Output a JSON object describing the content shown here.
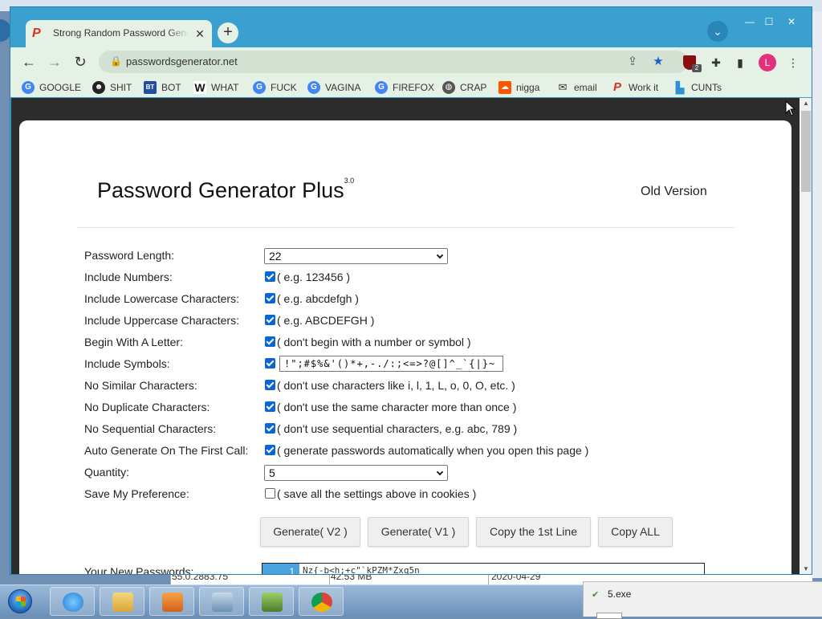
{
  "browser": {
    "tab_title": "Strong Random Password Generator",
    "tab_close": "✕",
    "new_tab": "+",
    "tab_search": "⌄",
    "url": "passwordsgenerator.net",
    "profile_initial": "L",
    "ublock_badge": "2",
    "window_controls": [
      "—",
      "☐",
      "✕"
    ]
  },
  "bookmarks": [
    {
      "label": "GOOGLE",
      "icon": "google-icon",
      "color": "#4285f4",
      "glyph": "G"
    },
    {
      "label": "SHIT",
      "icon": "smiley-icon",
      "color": "#222222",
      "glyph": "☻"
    },
    {
      "label": "BOT",
      "icon": "bt-icon",
      "color": "#1f4fa0",
      "glyph": "BT"
    },
    {
      "label": "WHAT",
      "icon": "w-icon",
      "color": "#111111",
      "glyph": "W"
    },
    {
      "label": "FUCK",
      "icon": "google-icon",
      "color": "#4285f4",
      "glyph": "G"
    },
    {
      "label": "VAGINA",
      "icon": "google-icon",
      "color": "#4285f4",
      "glyph": "G"
    },
    {
      "label": "FIREFOX",
      "icon": "google-icon",
      "color": "#4285f4",
      "glyph": "G"
    },
    {
      "label": "CRAP",
      "icon": "globe-icon",
      "color": "#555555",
      "glyph": "◍"
    },
    {
      "label": "nigga",
      "icon": "soundcloud-icon",
      "color": "#ff5500",
      "glyph": "☁"
    },
    {
      "label": "email",
      "icon": "mail-icon",
      "color": "#333333",
      "glyph": "✉"
    },
    {
      "label": "Work it",
      "icon": "p-icon",
      "color": "#d93025",
      "glyph": "P"
    },
    {
      "label": "CUNTs",
      "icon": "bookmark-icon",
      "color": "#2f8fd8",
      "glyph": "▙"
    }
  ],
  "page": {
    "title": "Password Generator Plus",
    "version": "3.0",
    "old_version": "Old Version",
    "options": [
      {
        "label": "Password Length:",
        "type": "select",
        "value": "22"
      },
      {
        "label": "Include Numbers:",
        "type": "checkbox",
        "checked": true,
        "hint": "( e.g. 123456 )"
      },
      {
        "label": "Include Lowercase Characters:",
        "type": "checkbox",
        "checked": true,
        "hint": "( e.g. abcdefgh )"
      },
      {
        "label": "Include Uppercase Characters:",
        "type": "checkbox",
        "checked": true,
        "hint": "( e.g. ABCDEFGH )"
      },
      {
        "label": "Begin With A Letter:",
        "type": "checkbox",
        "checked": true,
        "hint": "( don't begin with a number or symbol )"
      },
      {
        "label": "Include Symbols:",
        "type": "checkbox-input",
        "checked": true,
        "value": "!\";#$%&'()*+,-./:;<=>?@[]^_`{|}~"
      },
      {
        "label": "No Similar Characters:",
        "type": "checkbox",
        "checked": true,
        "hint": "( don't use characters like i, l, 1, L, o, 0, O, etc. )"
      },
      {
        "label": "No Duplicate Characters:",
        "type": "checkbox",
        "checked": true,
        "hint": "( don't use the same character more than once )"
      },
      {
        "label": "No Sequential Characters:",
        "type": "checkbox",
        "checked": true,
        "hint": "( don't use sequential characters, e.g. abc, 789 )"
      },
      {
        "label": "Auto Generate On The First Call:",
        "type": "checkbox",
        "checked": true,
        "hint": "( generate passwords automatically when you open this page )"
      },
      {
        "label": "Quantity:",
        "type": "select",
        "value": "5"
      },
      {
        "label": "Save My Preference:",
        "type": "checkbox",
        "checked": false,
        "hint": "( save all the settings above in cookies )"
      }
    ],
    "buttons": [
      "Generate( V2 )",
      "Generate( V1 )",
      "Copy the 1st Line",
      "Copy ALL"
    ],
    "output_label": "Your New Passwords:",
    "passwords": [
      {
        "line": "1",
        "value": "Nz{-b<h;+c\"`kPZM*Zxq5n"
      }
    ]
  },
  "background_window": {
    "cells": [
      "55.0.2883.75",
      "42.53 MB",
      "2020-04-29"
    ]
  },
  "notification": {
    "title": "5.exe"
  },
  "taskbar": {
    "apps": [
      {
        "name": "ie-icon",
        "color": "#1e7fd8"
      },
      {
        "name": "explorer-icon",
        "color": "#e8b84a"
      },
      {
        "name": "media-player-icon",
        "color": "#e07020"
      },
      {
        "name": "app-icon",
        "color": "#6b8fb3"
      },
      {
        "name": "installer-icon",
        "color": "#5a7d3a"
      },
      {
        "name": "chrome-icon",
        "color": "#db4437"
      }
    ]
  }
}
